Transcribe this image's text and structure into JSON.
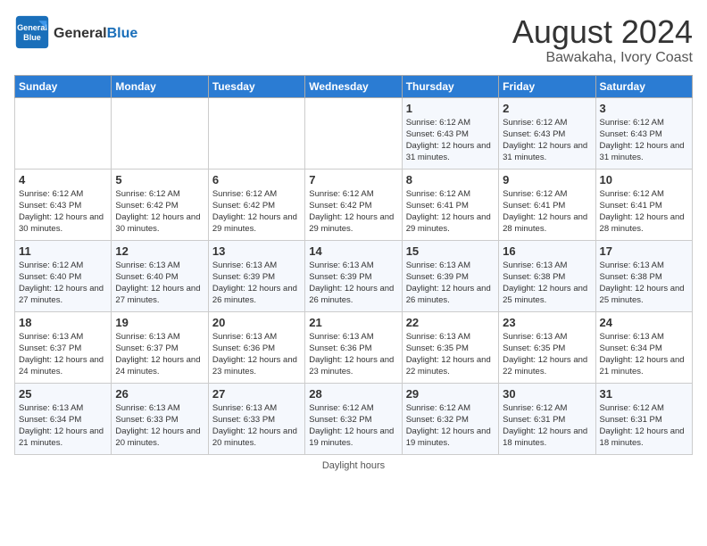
{
  "header": {
    "logo_line1": "General",
    "logo_line2": "Blue",
    "main_title": "August 2024",
    "subtitle": "Bawakaha, Ivory Coast"
  },
  "days_of_week": [
    "Sunday",
    "Monday",
    "Tuesday",
    "Wednesday",
    "Thursday",
    "Friday",
    "Saturday"
  ],
  "weeks": [
    [
      {
        "day": "",
        "info": ""
      },
      {
        "day": "",
        "info": ""
      },
      {
        "day": "",
        "info": ""
      },
      {
        "day": "",
        "info": ""
      },
      {
        "day": "1",
        "info": "Sunrise: 6:12 AM\nSunset: 6:43 PM\nDaylight: 12 hours and 31 minutes."
      },
      {
        "day": "2",
        "info": "Sunrise: 6:12 AM\nSunset: 6:43 PM\nDaylight: 12 hours and 31 minutes."
      },
      {
        "day": "3",
        "info": "Sunrise: 6:12 AM\nSunset: 6:43 PM\nDaylight: 12 hours and 31 minutes."
      }
    ],
    [
      {
        "day": "4",
        "info": "Sunrise: 6:12 AM\nSunset: 6:43 PM\nDaylight: 12 hours and 30 minutes."
      },
      {
        "day": "5",
        "info": "Sunrise: 6:12 AM\nSunset: 6:42 PM\nDaylight: 12 hours and 30 minutes."
      },
      {
        "day": "6",
        "info": "Sunrise: 6:12 AM\nSunset: 6:42 PM\nDaylight: 12 hours and 29 minutes."
      },
      {
        "day": "7",
        "info": "Sunrise: 6:12 AM\nSunset: 6:42 PM\nDaylight: 12 hours and 29 minutes."
      },
      {
        "day": "8",
        "info": "Sunrise: 6:12 AM\nSunset: 6:41 PM\nDaylight: 12 hours and 29 minutes."
      },
      {
        "day": "9",
        "info": "Sunrise: 6:12 AM\nSunset: 6:41 PM\nDaylight: 12 hours and 28 minutes."
      },
      {
        "day": "10",
        "info": "Sunrise: 6:12 AM\nSunset: 6:41 PM\nDaylight: 12 hours and 28 minutes."
      }
    ],
    [
      {
        "day": "11",
        "info": "Sunrise: 6:12 AM\nSunset: 6:40 PM\nDaylight: 12 hours and 27 minutes."
      },
      {
        "day": "12",
        "info": "Sunrise: 6:13 AM\nSunset: 6:40 PM\nDaylight: 12 hours and 27 minutes."
      },
      {
        "day": "13",
        "info": "Sunrise: 6:13 AM\nSunset: 6:39 PM\nDaylight: 12 hours and 26 minutes."
      },
      {
        "day": "14",
        "info": "Sunrise: 6:13 AM\nSunset: 6:39 PM\nDaylight: 12 hours and 26 minutes."
      },
      {
        "day": "15",
        "info": "Sunrise: 6:13 AM\nSunset: 6:39 PM\nDaylight: 12 hours and 26 minutes."
      },
      {
        "day": "16",
        "info": "Sunrise: 6:13 AM\nSunset: 6:38 PM\nDaylight: 12 hours and 25 minutes."
      },
      {
        "day": "17",
        "info": "Sunrise: 6:13 AM\nSunset: 6:38 PM\nDaylight: 12 hours and 25 minutes."
      }
    ],
    [
      {
        "day": "18",
        "info": "Sunrise: 6:13 AM\nSunset: 6:37 PM\nDaylight: 12 hours and 24 minutes."
      },
      {
        "day": "19",
        "info": "Sunrise: 6:13 AM\nSunset: 6:37 PM\nDaylight: 12 hours and 24 minutes."
      },
      {
        "day": "20",
        "info": "Sunrise: 6:13 AM\nSunset: 6:36 PM\nDaylight: 12 hours and 23 minutes."
      },
      {
        "day": "21",
        "info": "Sunrise: 6:13 AM\nSunset: 6:36 PM\nDaylight: 12 hours and 23 minutes."
      },
      {
        "day": "22",
        "info": "Sunrise: 6:13 AM\nSunset: 6:35 PM\nDaylight: 12 hours and 22 minutes."
      },
      {
        "day": "23",
        "info": "Sunrise: 6:13 AM\nSunset: 6:35 PM\nDaylight: 12 hours and 22 minutes."
      },
      {
        "day": "24",
        "info": "Sunrise: 6:13 AM\nSunset: 6:34 PM\nDaylight: 12 hours and 21 minutes."
      }
    ],
    [
      {
        "day": "25",
        "info": "Sunrise: 6:13 AM\nSunset: 6:34 PM\nDaylight: 12 hours and 21 minutes."
      },
      {
        "day": "26",
        "info": "Sunrise: 6:13 AM\nSunset: 6:33 PM\nDaylight: 12 hours and 20 minutes."
      },
      {
        "day": "27",
        "info": "Sunrise: 6:13 AM\nSunset: 6:33 PM\nDaylight: 12 hours and 20 minutes."
      },
      {
        "day": "28",
        "info": "Sunrise: 6:12 AM\nSunset: 6:32 PM\nDaylight: 12 hours and 19 minutes."
      },
      {
        "day": "29",
        "info": "Sunrise: 6:12 AM\nSunset: 6:32 PM\nDaylight: 12 hours and 19 minutes."
      },
      {
        "day": "30",
        "info": "Sunrise: 6:12 AM\nSunset: 6:31 PM\nDaylight: 12 hours and 18 minutes."
      },
      {
        "day": "31",
        "info": "Sunrise: 6:12 AM\nSunset: 6:31 PM\nDaylight: 12 hours and 18 minutes."
      }
    ]
  ],
  "footer": "Daylight hours"
}
